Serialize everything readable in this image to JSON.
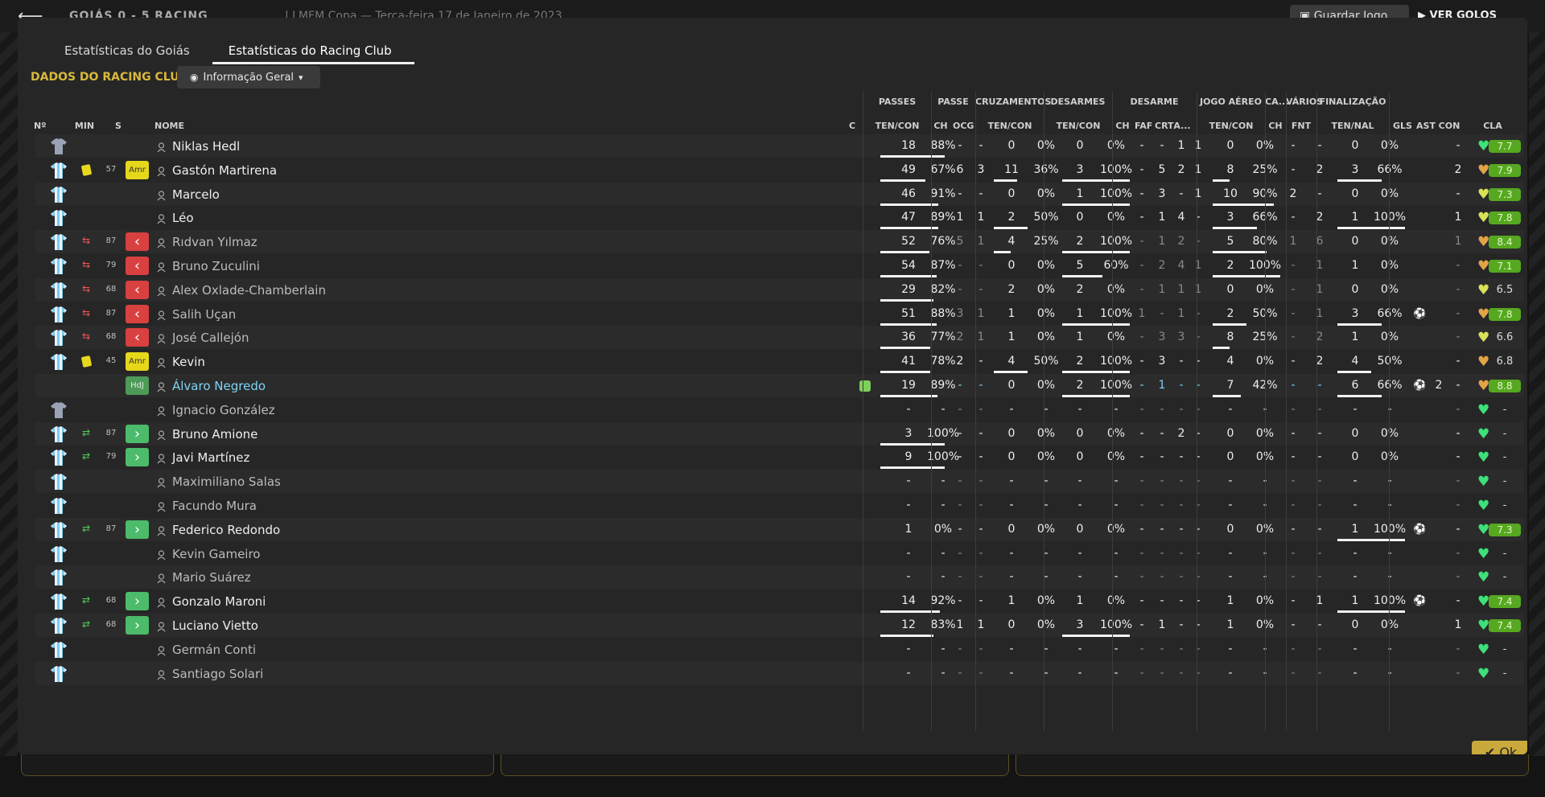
{
  "background": {
    "score": "GOIÁS  0 - 5  RACING",
    "competition": "LMFM Copa",
    "date": "Terça-feira 17 de Janeiro de 2023",
    "save_label": "Guardar Jogo",
    "goals_label": "VER GOLOS"
  },
  "tabs": [
    "Estatísticas do Goiás",
    "Estatísticas do Racing Club"
  ],
  "active_tab": 1,
  "section_title": "DADOS DO RACING CLUB",
  "view_dropdown": "Informação Geral",
  "ok_label": "Ok",
  "group_headers": [
    "PASSES",
    "PASSE",
    "CRUZAMENTOS",
    "DESARMES",
    "DESARME",
    "JOGO AÉREO",
    "CA...",
    "VÁRIOS",
    "FINALIZAÇÃO"
  ],
  "columns": {
    "no": "Nº",
    "min": "MIN",
    "s": "S",
    "name": "NOME",
    "c": "C",
    "passes": "TEN/CON",
    "pch": "CH",
    "pocg": "OCG",
    "cross": "TEN/CON",
    "tackles": "TEN/CON",
    "dch": "CH",
    "faf": "FAF",
    "crt": "CRT",
    "da": "A...",
    "air": "TEN/CON",
    "cach": "CH",
    "fnt": "FNT",
    "shots": "TEN/NAL",
    "gls": "GLS",
    "ast": "AST",
    "con": "CON",
    "cla": "CLA"
  },
  "colors": {
    "accent": "#d8b93c",
    "yellow_card": "#e8d81c",
    "sub_out": "#d94040",
    "sub_in": "#4cbb6b",
    "rating_green": "#56a821",
    "highlight_name": "#7fd3f5",
    "heart_green": "#3fe07a",
    "heart_yellow": "#d6e35a",
    "heart_orange": "#e3a34a"
  },
  "players": [
    {
      "shirt": "gk",
      "card": "",
      "subicon": "",
      "min": "",
      "badge": "",
      "name": "Niklas Hedl",
      "style": "",
      "c": false,
      "pa": "18",
      "pp": "88%",
      "pch": "-",
      "pocg": "-",
      "ca": "0",
      "cp": "0%",
      "ta": "0",
      "tp": "0%",
      "dch": "-",
      "faf": "-",
      "crt": "1",
      "da": "1",
      "aa": "0",
      "ap": "0%",
      "cach": "-",
      "fnt": "-",
      "sa": "0",
      "sp": "0%",
      "ball": "",
      "gls": "",
      "ast": "-",
      "heart": "green",
      "rating": "7.7",
      "rstyle": "green",
      "dim": false,
      "bars": {
        "p": 1,
        "c": 0,
        "t": 0,
        "a": 0,
        "s": 0
      }
    },
    {
      "shirt": "field",
      "card": "yellow",
      "subicon": "",
      "min": "57",
      "badge": "Amr",
      "name": "Gastón Martirena",
      "style": "",
      "c": false,
      "pa": "49",
      "pp": "67%",
      "pch": "6",
      "pocg": "3",
      "ca": "11",
      "cp": "36%",
      "ta": "3",
      "tp": "100%",
      "dch": "-",
      "faf": "5",
      "crt": "2",
      "da": "1",
      "aa": "8",
      "ap": "25%",
      "cach": "-",
      "fnt": "2",
      "sa": "3",
      "sp": "66%",
      "ball": "",
      "gls": "",
      "ast": "2",
      "heart": "orange",
      "rating": "7.9",
      "rstyle": "green",
      "dim": false,
      "bars": {
        "p": 0.7,
        "c": 0.35,
        "t": 1,
        "a": 0.25,
        "s": 0.66
      }
    },
    {
      "shirt": "field",
      "card": "",
      "subicon": "",
      "min": "",
      "badge": "",
      "name": "Marcelo",
      "style": "",
      "c": false,
      "pa": "46",
      "pp": "91%",
      "pch": "-",
      "pocg": "-",
      "ca": "0",
      "cp": "0%",
      "ta": "1",
      "tp": "100%",
      "dch": "-",
      "faf": "3",
      "crt": "-",
      "da": "1",
      "aa": "10",
      "ap": "90%",
      "cach": "2",
      "fnt": "-",
      "sa": "0",
      "sp": "0%",
      "ball": "",
      "gls": "",
      "ast": "-",
      "heart": "yellow",
      "rating": "7.3",
      "rstyle": "green",
      "dim": false,
      "bars": {
        "p": 0.9,
        "c": 0,
        "t": 1,
        "a": 0.9,
        "s": 0
      }
    },
    {
      "shirt": "field",
      "card": "",
      "subicon": "",
      "min": "",
      "badge": "",
      "name": "Léo",
      "style": "",
      "c": false,
      "pa": "47",
      "pp": "89%",
      "pch": "1",
      "pocg": "1",
      "ca": "2",
      "cp": "50%",
      "ta": "0",
      "tp": "0%",
      "dch": "-",
      "faf": "1",
      "crt": "4",
      "da": "-",
      "aa": "3",
      "ap": "66%",
      "cach": "-",
      "fnt": "2",
      "sa": "1",
      "sp": "100%",
      "ball": "",
      "gls": "",
      "ast": "1",
      "heart": "yellow",
      "rating": "7.8",
      "rstyle": "green",
      "dim": false,
      "bars": {
        "p": 0.9,
        "c": 0.5,
        "t": 0,
        "a": 0.66,
        "s": 1
      }
    },
    {
      "shirt": "field",
      "card": "",
      "subicon": "out",
      "min": "87",
      "badge": "out",
      "name": "Rıdvan Yılmaz",
      "style": "dim",
      "c": false,
      "pa": "52",
      "pp": "76%",
      "pch": "5",
      "pocg": "1",
      "ca": "4",
      "cp": "25%",
      "ta": "2",
      "tp": "100%",
      "dch": "-",
      "faf": "1",
      "crt": "2",
      "da": "-",
      "aa": "5",
      "ap": "80%",
      "cach": "1",
      "fnt": "6",
      "sa": "0",
      "sp": "0%",
      "ball": "",
      "gls": "",
      "ast": "1",
      "heart": "orange",
      "rating": "8.4",
      "rstyle": "green",
      "dim": true,
      "bars": {
        "p": 0.76,
        "c": 0.25,
        "t": 1,
        "a": 0.8,
        "s": 0
      }
    },
    {
      "shirt": "field",
      "card": "",
      "subicon": "out",
      "min": "79",
      "badge": "out",
      "name": "Bruno Zuculini",
      "style": "dim",
      "c": false,
      "pa": "54",
      "pp": "87%",
      "pch": "-",
      "pocg": "-",
      "ca": "0",
      "cp": "0%",
      "ta": "5",
      "tp": "60%",
      "dch": "-",
      "faf": "2",
      "crt": "4",
      "da": "1",
      "aa": "2",
      "ap": "100%",
      "cach": "-",
      "fnt": "1",
      "sa": "1",
      "sp": "0%",
      "ball": "",
      "gls": "",
      "ast": "-",
      "heart": "orange",
      "rating": "7.1",
      "rstyle": "green",
      "dim": true,
      "bars": {
        "p": 0.87,
        "c": 0,
        "t": 0.6,
        "a": 1,
        "s": 0
      }
    },
    {
      "shirt": "field",
      "card": "",
      "subicon": "out",
      "min": "68",
      "badge": "out",
      "name": "Alex Oxlade-Chamberlain",
      "style": "dim",
      "c": false,
      "pa": "29",
      "pp": "82%",
      "pch": "-",
      "pocg": "-",
      "ca": "2",
      "cp": "0%",
      "ta": "2",
      "tp": "0%",
      "dch": "-",
      "faf": "1",
      "crt": "1",
      "da": "1",
      "aa": "0",
      "ap": "0%",
      "cach": "-",
      "fnt": "1",
      "sa": "0",
      "sp": "0%",
      "ball": "",
      "gls": "",
      "ast": "-",
      "heart": "yellow",
      "rating": "6.5",
      "rstyle": "plain",
      "dim": true,
      "bars": {
        "p": 0.82,
        "c": 0,
        "t": 0,
        "a": 0,
        "s": 0
      }
    },
    {
      "shirt": "field",
      "card": "",
      "subicon": "out",
      "min": "87",
      "badge": "out",
      "name": "Salih Uçan",
      "style": "dim",
      "c": false,
      "pa": "51",
      "pp": "88%",
      "pch": "3",
      "pocg": "1",
      "ca": "1",
      "cp": "0%",
      "ta": "1",
      "tp": "100%",
      "dch": "1",
      "faf": "-",
      "crt": "1",
      "da": "-",
      "aa": "2",
      "ap": "50%",
      "cach": "-",
      "fnt": "1",
      "sa": "3",
      "sp": "66%",
      "ball": "⚽",
      "gls": "",
      "ast": "-",
      "heart": "orange",
      "rating": "7.8",
      "rstyle": "green",
      "dim": true,
      "bars": {
        "p": 0.88,
        "c": 0,
        "t": 1,
        "a": 0.5,
        "s": 0.66
      }
    },
    {
      "shirt": "field",
      "card": "",
      "subicon": "out",
      "min": "68",
      "badge": "out",
      "name": "José Callejón",
      "style": "dim",
      "c": false,
      "pa": "36",
      "pp": "77%",
      "pch": "2",
      "pocg": "1",
      "ca": "1",
      "cp": "0%",
      "ta": "1",
      "tp": "0%",
      "dch": "-",
      "faf": "3",
      "crt": "3",
      "da": "-",
      "aa": "8",
      "ap": "25%",
      "cach": "-",
      "fnt": "2",
      "sa": "1",
      "sp": "0%",
      "ball": "",
      "gls": "",
      "ast": "-",
      "heart": "yellow",
      "rating": "6.6",
      "rstyle": "plain",
      "dim": true,
      "bars": {
        "p": 0.77,
        "c": 0,
        "t": 0,
        "a": 0.25,
        "s": 0
      }
    },
    {
      "shirt": "field",
      "card": "yellow",
      "subicon": "",
      "min": "45",
      "badge": "Amr",
      "name": "Kevin",
      "style": "",
      "c": false,
      "pa": "41",
      "pp": "78%",
      "pch": "2",
      "pocg": "-",
      "ca": "4",
      "cp": "50%",
      "ta": "2",
      "tp": "100%",
      "dch": "-",
      "faf": "3",
      "crt": "-",
      "da": "-",
      "aa": "4",
      "ap": "0%",
      "cach": "-",
      "fnt": "2",
      "sa": "4",
      "sp": "50%",
      "ball": "",
      "gls": "",
      "ast": "-",
      "heart": "orange",
      "rating": "6.8",
      "rstyle": "plain",
      "dim": false,
      "bars": {
        "p": 0.78,
        "c": 0.5,
        "t": 1,
        "a": 0,
        "s": 0.5
      }
    },
    {
      "shirt": "none",
      "card": "",
      "subicon": "",
      "min": "",
      "badge": "HdJ",
      "name": "Álvaro Negredo",
      "style": "hl",
      "c": true,
      "pa": "19",
      "pp": "89%",
      "pch": "-",
      "pocg": "-",
      "ca": "0",
      "cp": "0%",
      "ta": "2",
      "tp": "100%",
      "dch": "-",
      "faf": "1",
      "crt": "-",
      "da": "-",
      "aa": "7",
      "ap": "42%",
      "cach": "-",
      "fnt": "-",
      "sa": "6",
      "sp": "66%",
      "ball": "⚽",
      "gls": "2",
      "ast": "-",
      "heart": "orange",
      "rating": "8.8",
      "rstyle": "green",
      "dim": false,
      "cyan": true,
      "bars": {
        "p": 0.89,
        "c": 0,
        "t": 1,
        "a": 0.42,
        "s": 0.66
      }
    },
    {
      "shirt": "gk",
      "card": "",
      "subicon": "",
      "min": "",
      "badge": "",
      "name": "Ignacio González",
      "style": "dim",
      "c": false,
      "pa": "-",
      "pp": "-",
      "pch": "-",
      "pocg": "-",
      "ca": "-",
      "cp": "-",
      "ta": "-",
      "tp": "-",
      "dch": "-",
      "faf": "-",
      "crt": "-",
      "da": "-",
      "aa": "-",
      "ap": "-",
      "cach": "-",
      "fnt": "-",
      "sa": "-",
      "sp": "-",
      "ball": "",
      "gls": "",
      "ast": "-",
      "heart": "green",
      "rating": "-",
      "rstyle": "plain",
      "dim": true,
      "bars": {
        "p": 0,
        "c": 0,
        "t": 0,
        "a": 0,
        "s": 0
      }
    },
    {
      "shirt": "field",
      "card": "",
      "subicon": "in",
      "min": "87",
      "badge": "in",
      "name": "Bruno Amione",
      "style": "",
      "c": false,
      "pa": "3",
      "pp": "100%",
      "pch": "-",
      "pocg": "-",
      "ca": "0",
      "cp": "0%",
      "ta": "0",
      "tp": "0%",
      "dch": "-",
      "faf": "-",
      "crt": "2",
      "da": "-",
      "aa": "0",
      "ap": "0%",
      "cach": "-",
      "fnt": "-",
      "sa": "0",
      "sp": "0%",
      "ball": "",
      "gls": "",
      "ast": "-",
      "heart": "green",
      "rating": "-",
      "rstyle": "plain",
      "dim": false,
      "bars": {
        "p": 1,
        "c": 0,
        "t": 0,
        "a": 0,
        "s": 0
      }
    },
    {
      "shirt": "field",
      "card": "",
      "subicon": "in",
      "min": "79",
      "badge": "in",
      "name": "Javi Martínez",
      "style": "",
      "c": false,
      "pa": "9",
      "pp": "100%",
      "pch": "-",
      "pocg": "-",
      "ca": "0",
      "cp": "0%",
      "ta": "0",
      "tp": "0%",
      "dch": "-",
      "faf": "-",
      "crt": "-",
      "da": "-",
      "aa": "0",
      "ap": "0%",
      "cach": "-",
      "fnt": "-",
      "sa": "0",
      "sp": "0%",
      "ball": "",
      "gls": "",
      "ast": "-",
      "heart": "green",
      "rating": "-",
      "rstyle": "plain",
      "dim": false,
      "bars": {
        "p": 1,
        "c": 0,
        "t": 0,
        "a": 0,
        "s": 0
      }
    },
    {
      "shirt": "field",
      "card": "",
      "subicon": "",
      "min": "",
      "badge": "",
      "name": "Maximiliano Salas",
      "style": "dim",
      "c": false,
      "pa": "-",
      "pp": "-",
      "pch": "-",
      "pocg": "-",
      "ca": "-",
      "cp": "-",
      "ta": "-",
      "tp": "-",
      "dch": "-",
      "faf": "-",
      "crt": "-",
      "da": "-",
      "aa": "-",
      "ap": "-",
      "cach": "-",
      "fnt": "-",
      "sa": "-",
      "sp": "-",
      "ball": "",
      "gls": "",
      "ast": "-",
      "heart": "green",
      "rating": "-",
      "rstyle": "plain",
      "dim": true,
      "bars": {
        "p": 0,
        "c": 0,
        "t": 0,
        "a": 0,
        "s": 0
      }
    },
    {
      "shirt": "field",
      "card": "",
      "subicon": "",
      "min": "",
      "badge": "",
      "name": "Facundo Mura",
      "style": "dim",
      "c": false,
      "pa": "-",
      "pp": "-",
      "pch": "-",
      "pocg": "-",
      "ca": "-",
      "cp": "-",
      "ta": "-",
      "tp": "-",
      "dch": "-",
      "faf": "-",
      "crt": "-",
      "da": "-",
      "aa": "-",
      "ap": "-",
      "cach": "-",
      "fnt": "-",
      "sa": "-",
      "sp": "-",
      "ball": "",
      "gls": "",
      "ast": "-",
      "heart": "green",
      "rating": "-",
      "rstyle": "plain",
      "dim": true,
      "bars": {
        "p": 0,
        "c": 0,
        "t": 0,
        "a": 0,
        "s": 0
      }
    },
    {
      "shirt": "field",
      "card": "",
      "subicon": "in",
      "min": "87",
      "badge": "in",
      "name": "Federico Redondo",
      "style": "",
      "c": false,
      "pa": "1",
      "pp": "0%",
      "pch": "-",
      "pocg": "-",
      "ca": "0",
      "cp": "0%",
      "ta": "0",
      "tp": "0%",
      "dch": "-",
      "faf": "-",
      "crt": "-",
      "da": "-",
      "aa": "0",
      "ap": "0%",
      "cach": "-",
      "fnt": "-",
      "sa": "1",
      "sp": "100%",
      "ball": "⚽",
      "gls": "",
      "ast": "-",
      "heart": "green",
      "rating": "7.3",
      "rstyle": "green",
      "dim": false,
      "bars": {
        "p": 0,
        "c": 0,
        "t": 0,
        "a": 0,
        "s": 1
      }
    },
    {
      "shirt": "field",
      "card": "",
      "subicon": "",
      "min": "",
      "badge": "",
      "name": "Kevin Gameiro",
      "style": "dim",
      "c": false,
      "pa": "-",
      "pp": "-",
      "pch": "-",
      "pocg": "-",
      "ca": "-",
      "cp": "-",
      "ta": "-",
      "tp": "-",
      "dch": "-",
      "faf": "-",
      "crt": "-",
      "da": "-",
      "aa": "-",
      "ap": "-",
      "cach": "-",
      "fnt": "-",
      "sa": "-",
      "sp": "-",
      "ball": "",
      "gls": "",
      "ast": "-",
      "heart": "green",
      "rating": "-",
      "rstyle": "plain",
      "dim": true,
      "bars": {
        "p": 0,
        "c": 0,
        "t": 0,
        "a": 0,
        "s": 0
      }
    },
    {
      "shirt": "field",
      "card": "",
      "subicon": "",
      "min": "",
      "badge": "",
      "name": "Mario Suárez",
      "style": "dim",
      "c": false,
      "pa": "-",
      "pp": "-",
      "pch": "-",
      "pocg": "-",
      "ca": "-",
      "cp": "-",
      "ta": "-",
      "tp": "-",
      "dch": "-",
      "faf": "-",
      "crt": "-",
      "da": "-",
      "aa": "-",
      "ap": "-",
      "cach": "-",
      "fnt": "-",
      "sa": "-",
      "sp": "-",
      "ball": "",
      "gls": "",
      "ast": "-",
      "heart": "green",
      "rating": "-",
      "rstyle": "plain",
      "dim": true,
      "bars": {
        "p": 0,
        "c": 0,
        "t": 0,
        "a": 0,
        "s": 0
      }
    },
    {
      "shirt": "field",
      "card": "",
      "subicon": "in",
      "min": "68",
      "badge": "in",
      "name": "Gonzalo Maroni",
      "style": "",
      "c": false,
      "pa": "14",
      "pp": "92%",
      "pch": "-",
      "pocg": "-",
      "ca": "1",
      "cp": "0%",
      "ta": "1",
      "tp": "0%",
      "dch": "-",
      "faf": "-",
      "crt": "-",
      "da": "-",
      "aa": "1",
      "ap": "0%",
      "cach": "-",
      "fnt": "1",
      "sa": "1",
      "sp": "100%",
      "ball": "⚽",
      "gls": "",
      "ast": "-",
      "heart": "green",
      "rating": "7.4",
      "rstyle": "green",
      "dim": false,
      "bars": {
        "p": 0.92,
        "c": 0,
        "t": 0,
        "a": 0,
        "s": 1
      }
    },
    {
      "shirt": "field",
      "card": "",
      "subicon": "in",
      "min": "68",
      "badge": "in",
      "name": "Luciano Vietto",
      "style": "",
      "c": false,
      "pa": "12",
      "pp": "83%",
      "pch": "1",
      "pocg": "1",
      "ca": "0",
      "cp": "0%",
      "ta": "3",
      "tp": "100%",
      "dch": "-",
      "faf": "1",
      "crt": "-",
      "da": "-",
      "aa": "1",
      "ap": "0%",
      "cach": "-",
      "fnt": "-",
      "sa": "0",
      "sp": "0%",
      "ball": "",
      "gls": "",
      "ast": "1",
      "heart": "green",
      "rating": "7.4",
      "rstyle": "green",
      "dim": false,
      "bars": {
        "p": 0.83,
        "c": 0,
        "t": 1,
        "a": 0,
        "s": 0
      }
    },
    {
      "shirt": "field",
      "card": "",
      "subicon": "",
      "min": "",
      "badge": "",
      "name": "Germán Conti",
      "style": "dim",
      "c": false,
      "pa": "-",
      "pp": "-",
      "pch": "-",
      "pocg": "-",
      "ca": "-",
      "cp": "-",
      "ta": "-",
      "tp": "-",
      "dch": "-",
      "faf": "-",
      "crt": "-",
      "da": "-",
      "aa": "-",
      "ap": "-",
      "cach": "-",
      "fnt": "-",
      "sa": "-",
      "sp": "-",
      "ball": "",
      "gls": "",
      "ast": "-",
      "heart": "green",
      "rating": "-",
      "rstyle": "plain",
      "dim": true,
      "bars": {
        "p": 0,
        "c": 0,
        "t": 0,
        "a": 0,
        "s": 0
      }
    },
    {
      "shirt": "field",
      "card": "",
      "subicon": "",
      "min": "",
      "badge": "",
      "name": "Santiago Solari",
      "style": "dim",
      "c": false,
      "pa": "-",
      "pp": "-",
      "pch": "-",
      "pocg": "-",
      "ca": "-",
      "cp": "-",
      "ta": "-",
      "tp": "-",
      "dch": "-",
      "faf": "-",
      "crt": "-",
      "da": "-",
      "aa": "-",
      "ap": "-",
      "cach": "-",
      "fnt": "-",
      "sa": "-",
      "sp": "-",
      "ball": "",
      "gls": "",
      "ast": "-",
      "heart": "green",
      "rating": "-",
      "rstyle": "plain",
      "dim": true,
      "bars": {
        "p": 0,
        "c": 0,
        "t": 0,
        "a": 0,
        "s": 0
      }
    }
  ]
}
